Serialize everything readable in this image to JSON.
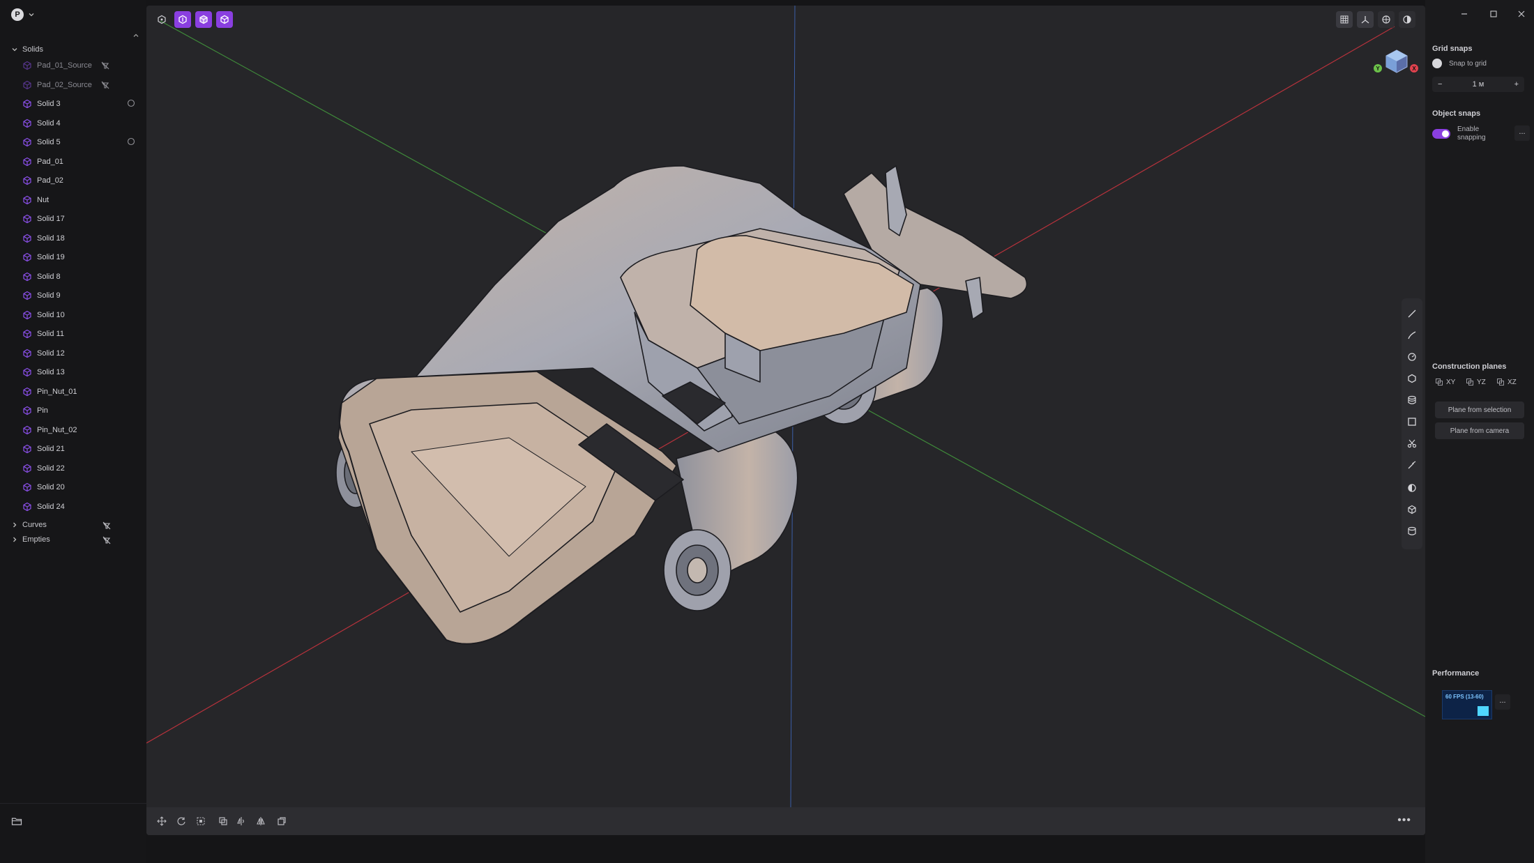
{
  "app": {
    "logo_letter": "P"
  },
  "sidebar": {
    "solids_header": "Solids",
    "items": [
      {
        "label": "Pad_01_Source",
        "dim": true,
        "trail": "hidden-icon"
      },
      {
        "label": "Pad_02_Source",
        "dim": true,
        "trail": "hidden-icon"
      },
      {
        "label": "Solid 3",
        "trail": "circle-icon"
      },
      {
        "label": "Solid 4"
      },
      {
        "label": "Solid 5",
        "trail": "circle-icon"
      },
      {
        "label": "Pad_01"
      },
      {
        "label": "Pad_02"
      },
      {
        "label": "Nut"
      },
      {
        "label": "Solid 17"
      },
      {
        "label": "Solid 18"
      },
      {
        "label": "Solid 19"
      },
      {
        "label": "Solid 8"
      },
      {
        "label": "Solid 9"
      },
      {
        "label": "Solid 10"
      },
      {
        "label": "Solid 11"
      },
      {
        "label": "Solid 12"
      },
      {
        "label": "Solid 13"
      },
      {
        "label": "Pin_Nut_01"
      },
      {
        "label": "Pin"
      },
      {
        "label": "Pin_Nut_02"
      },
      {
        "label": "Solid 21"
      },
      {
        "label": "Solid 22"
      },
      {
        "label": "Solid 20"
      },
      {
        "label": "Solid 24"
      }
    ],
    "curves_header": "Curves",
    "empties_header": "Empties"
  },
  "colors": {
    "accent": "#8a3fe0",
    "solid_icon": "#8a4fe8",
    "axis_x": "#b8323c",
    "axis_y": "#3f8a3a",
    "axis_z": "#3b5ea8"
  },
  "viewport": {
    "top_tools": [
      "select-icon",
      "solid-select-icon",
      "object-select-icon",
      "body-select-icon"
    ],
    "view_buttons": [
      "grid-icon",
      "axes-icon",
      "render-icon",
      "shading-icon"
    ],
    "gizmo": {
      "y_label": "Y",
      "x_label": "X"
    },
    "rail_tools": [
      "line-icon",
      "curve-icon",
      "circle-icon",
      "polygon-icon",
      "stack-icon",
      "rectangle-icon",
      "scissors-icon",
      "trim-icon",
      "sphere-icon",
      "cube-icon",
      "cylinder-icon"
    ],
    "bottom_tools": [
      "move-icon",
      "rotate-icon",
      "scale-icon",
      "duplicate-icon",
      "mirror-icon",
      "flip-icon",
      "copy-icon"
    ],
    "more_label": "•••"
  },
  "right_panel": {
    "grid_snaps_title": "Grid snaps",
    "snap_to_grid_label": "Snap to grid",
    "grid_step_value": "1 м",
    "minus_label": "−",
    "plus_label": "+",
    "object_snaps_title": "Object snaps",
    "enable_snapping_label_1": "Enable",
    "enable_snapping_label_2": "snapping",
    "object_snaps_more": "...",
    "construction_planes_title": "Construction planes",
    "planes": [
      "XY",
      "YZ",
      "XZ"
    ],
    "plane_from_selection": "Plane from selection",
    "plane_from_camera": "Plane from camera",
    "performance_title": "Performance",
    "fps_text": "60 FPS (13-60)",
    "fps_level": 0.5,
    "performance_more": "..."
  }
}
